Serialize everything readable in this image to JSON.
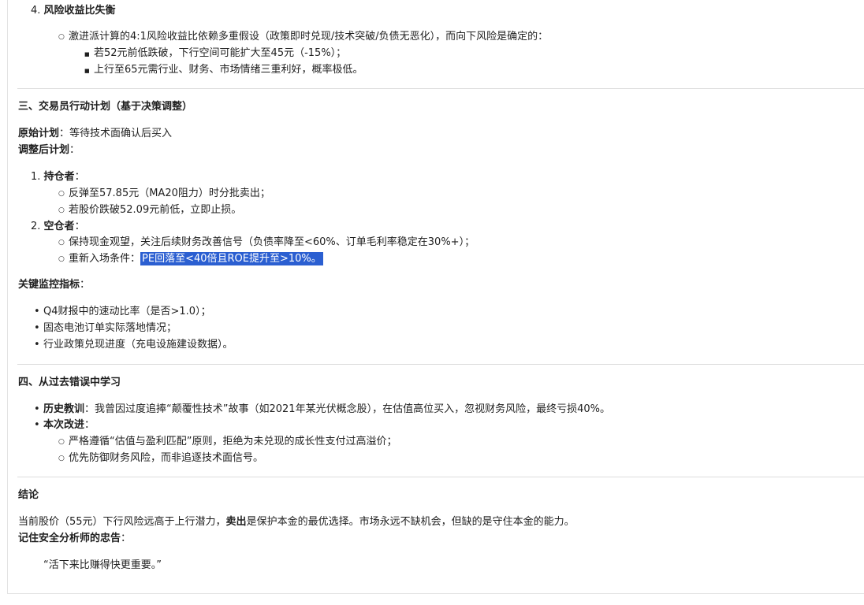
{
  "sec_risk": {
    "title_num": "4.",
    "title": "风险收益比失衡",
    "point": "激进派计算的4:1风险收益比依赖多重假设（政策即时兑现/技术突破/负债无恶化），而向下风险是确定的：",
    "sub": [
      "若52元前低跌破，下行空间可能扩大至45元（-15%）；",
      "上行至65元需行业、财务、市场情绪三重利好，概率极低。"
    ]
  },
  "sec3": {
    "heading": "三、交易员行动计划（基于决策调整）",
    "orig_label": "原始计划",
    "orig_text": "：等待技术面确认后买入",
    "adj_label": "调整后计划",
    "adj_colon": "：",
    "items": [
      {
        "num": "1.",
        "label": "持仓者",
        "colon": "：",
        "subs": [
          "反弹至57.85元（MA20阻力）时分批卖出；",
          "若股价跌破52.09元前低，立即止损。"
        ]
      },
      {
        "num": "2.",
        "label": "空仓者",
        "colon": "：",
        "subs": [
          "保持现金观望，关注后续财务改善信号（负债率降至<60%、订单毛利率稳定在30%+）；"
        ],
        "reentry_prefix": "重新入场条件：",
        "reentry_highlight": "PE回落至<40倍且ROE提升至>10%。"
      }
    ],
    "monitor_label": "关键监控指标",
    "monitor_colon": "：",
    "monitor_items": [
      "Q4财报中的速动比率（是否>1.0）；",
      "固态电池订单实际落地情况；",
      "行业政策兑现进度（充电设施建设数据）。"
    ]
  },
  "sec4": {
    "heading": "四、从过去错误中学习",
    "lesson_label": "历史教训",
    "lesson_text": "：我曾因过度追捧“颠覆性技术”故事（如2021年某光伏概念股），在估值高位买入，忽视财务风险，最终亏损40%。",
    "improve_label": "本次改进",
    "improve_colon": "：",
    "improve_items": [
      "严格遵循“估值与盈利匹配”原则，拒绝为未兑现的成长性支付过高溢价；",
      "优先防御财务风险，而非追逐技术面信号。"
    ]
  },
  "conclusion": {
    "heading": "结论",
    "text_a": "当前股价（55元）下行风险远高于上行潜力，",
    "text_bold": "卖出",
    "text_b": "是保护本金的最优选择。市场永远不缺机会，但缺的是守住本金的能力。",
    "advice_label": "记住安全分析师的忠告",
    "advice_colon": "：",
    "quote": "“活下来比赚得快更重要。”"
  },
  "colors": {
    "highlight": "#2b5fd1",
    "text": "#1f1f1f",
    "divider": "#dcdcdc"
  }
}
